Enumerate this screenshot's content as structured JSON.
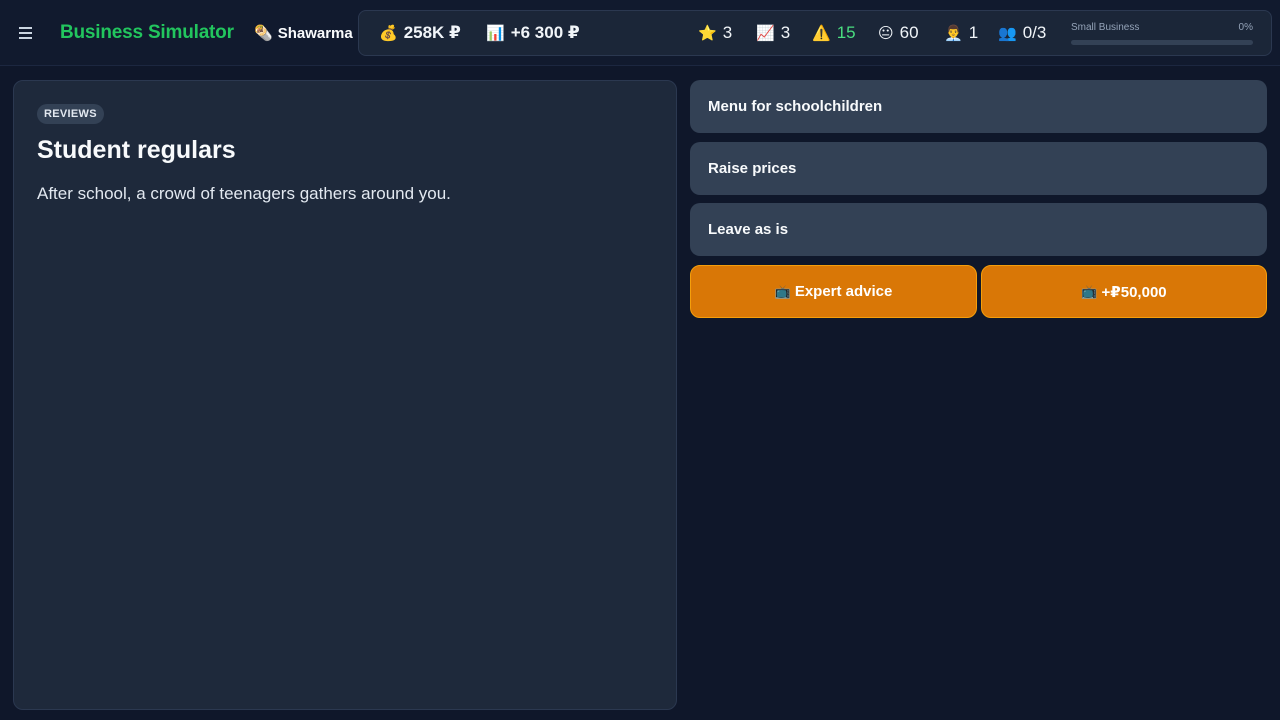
{
  "header": {
    "app_title": "Business Simulator",
    "business_icon": "🌯",
    "business_name": "Shawarma"
  },
  "stats": {
    "cash": {
      "icon": "💰",
      "icon_name": "money-bag-icon",
      "value": "258K ₽"
    },
    "income": {
      "icon": "📊",
      "icon_name": "bar-chart-icon",
      "value": "+6 300 ₽"
    },
    "rating": {
      "icon": "⭐",
      "icon_name": "star-icon",
      "value": "3"
    },
    "growth": {
      "icon": "📈",
      "icon_name": "trend-up-icon",
      "value": "3"
    },
    "risk": {
      "icon": "⚠️",
      "icon_name": "warning-icon",
      "value": "15"
    },
    "mood": {
      "icon": "😐",
      "icon_name": "neutral-face-icon",
      "value": "60"
    },
    "staff": {
      "icon": "👨‍💼",
      "icon_name": "employee-icon",
      "value": "1"
    },
    "team": {
      "icon": "👥",
      "icon_name": "people-icon",
      "value": "0/3"
    }
  },
  "level": {
    "label": "Small Business",
    "percent_text": "0%",
    "progress": 0
  },
  "event": {
    "category": "REVIEWS",
    "title": "Student regulars",
    "description": "After school, a crowd of teenagers gathers around you."
  },
  "choices": [
    {
      "label": "Menu for schoolchildren"
    },
    {
      "label": "Raise prices"
    },
    {
      "label": "Leave as is"
    }
  ],
  "actions": {
    "expert": {
      "icon": "📺",
      "label": "Expert advice"
    },
    "bonus": {
      "icon": "📺",
      "label": "+₽50,000"
    }
  },
  "colors": {
    "accent_green": "#22c55e",
    "action_orange": "#d97706",
    "background": "#0f172a",
    "card": "#1e293b"
  }
}
